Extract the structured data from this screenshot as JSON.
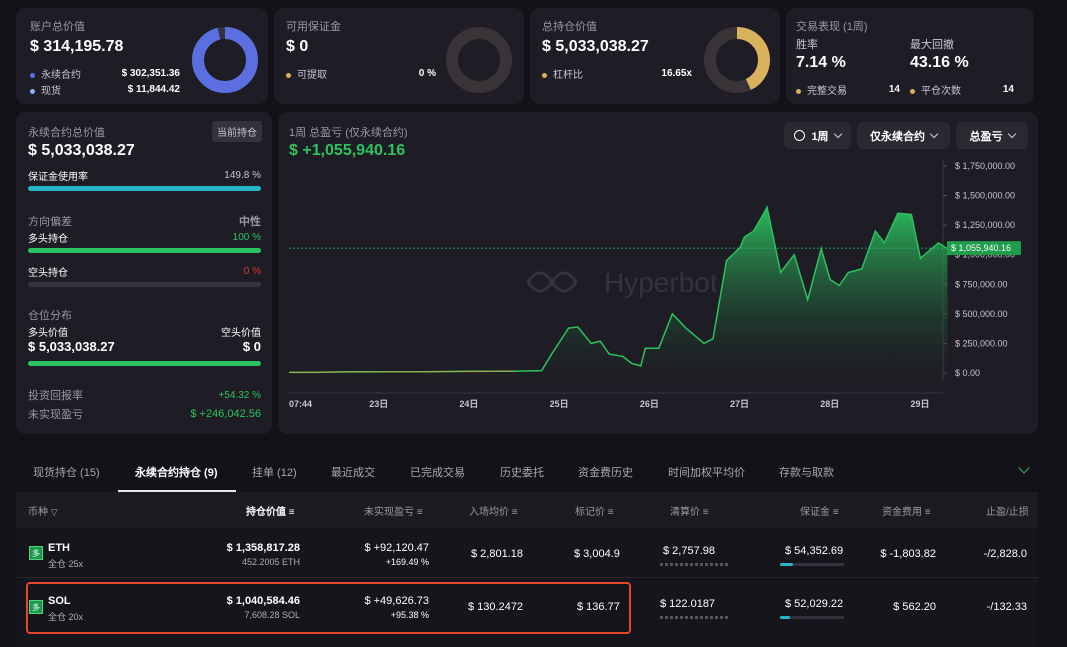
{
  "cards": {
    "account": {
      "label": "账户总价值",
      "value": "$ 314,195.78",
      "perp_label": "永续合约",
      "perp_value": "$ 302,351.36",
      "spot_label": "现货",
      "spot_value": "$ 11,844.42",
      "perp_fraction": 0.962
    },
    "margin": {
      "label": "可用保证金",
      "value": "$ 0",
      "withdraw_label": "可提取",
      "withdraw_value": "0 %",
      "fraction": 0
    },
    "position": {
      "label": "总持仓价值",
      "value": "$ 5,033,038.27",
      "leverage_label": "杠杆比",
      "leverage_value": "16.65x",
      "fraction": 0.43
    },
    "trading": {
      "label": "交易表现 (1周)",
      "winrate_label": "胜率",
      "winrate_value": "7.14 %",
      "drawdown_label": "最大回撤",
      "drawdown_value": "43.16 %",
      "completed_label": "完整交易",
      "completed_value": "14",
      "closes_label": "平仓次数",
      "closes_value": "14"
    }
  },
  "perp_panel": {
    "title": "永续合约总价值",
    "badge": "当前持仓",
    "value": "$ 5,033,038.27",
    "margin_usage_label": "保证金使用率",
    "margin_usage_value": "149.8 %",
    "bias_label": "方向偏差",
    "bias_value": "中性",
    "long_label": "多头持仓",
    "long_value": "100 %",
    "short_label": "空头持仓",
    "short_value": "0 %",
    "dist_label": "仓位分布",
    "long_val_label": "多头价值",
    "short_val_label": "空头价值",
    "long_val": "$ 5,033,038.27",
    "short_val": "$ 0",
    "roi_label": "投资回报率",
    "roi_value": "+54.32 %",
    "upnl_label": "未实现盈亏",
    "upnl_value": "$ +246,042.56"
  },
  "chart_header": {
    "title": "1周 总盈亏 (仅永续合约)",
    "value": "$ +1,055,940.16",
    "range_label": "1周",
    "filter_label": "仅永续合约",
    "metric_label": "总盈亏",
    "watermark": "Hyperbot"
  },
  "chart_data": {
    "type": "area",
    "x_labels": [
      "07:44",
      "23日",
      "24日",
      "25日",
      "26日",
      "27日",
      "28日",
      "29日"
    ],
    "y_ticks": [
      "$ 1,750,000.00",
      "$ 1,500,000.00",
      "$ 1,250,000.00",
      "$ 1,000,000.00",
      "$ 750,000.00",
      "$ 500,000.00",
      "$ 250,000.00",
      "$ 0.00"
    ],
    "ylim": [
      0,
      1750000
    ],
    "x_range": [
      0,
      7.25
    ],
    "current_label": "$ 1,055,940.16",
    "current_value": 1055940,
    "series": [
      {
        "x": [
          0,
          0.3,
          0.6,
          1,
          1.5,
          2,
          2.5,
          2.8,
          2.92,
          3.1,
          3.2,
          3.35,
          3.45,
          3.55,
          3.7,
          3.8,
          3.9,
          3.95,
          4.1,
          4.25,
          4.4,
          4.6,
          4.7,
          4.85,
          5,
          5.05,
          5.15,
          5.3,
          5.45,
          5.6,
          5.75,
          5.9,
          6,
          6.1,
          6.2,
          6.35,
          6.5,
          6.6,
          6.75,
          6.9,
          7,
          7.2,
          7.3
        ],
        "y": [
          5000,
          5000,
          10000,
          10000,
          10000,
          15000,
          15000,
          20000,
          170000,
          380000,
          390000,
          250000,
          270000,
          160000,
          140000,
          80000,
          60000,
          210000,
          210000,
          500000,
          380000,
          250000,
          290000,
          950000,
          1060000,
          1150000,
          1200000,
          1400000,
          850000,
          1000000,
          620000,
          1050000,
          790000,
          740000,
          850000,
          880000,
          1200000,
          1100000,
          1350000,
          1340000,
          970000,
          1100000,
          1050000
        ]
      }
    ]
  },
  "tabs": [
    "现货持仓 (15)",
    "永续合约持仓 (9)",
    "挂单 (12)",
    "最近成交",
    "已完成交易",
    "历史委托",
    "资金费历史",
    "时间加权平均价",
    "存款与取款"
  ],
  "table": {
    "headers": [
      "币种",
      "持仓价值",
      "未实现盈亏",
      "入场均价",
      "标记价",
      "清算价",
      "保证金",
      "资金费用",
      "止盈/止损"
    ],
    "rows": [
      {
        "badge": "多",
        "coin": "ETH",
        "mode": "全仓 25x",
        "value": "$ 1,358,817.28",
        "size": "452.2005 ETH",
        "pnl": "$ +92,120.47",
        "pnl_pct": "+169.49 %",
        "entry": "$ 2,801.18",
        "mark": "$ 3,004.9",
        "liq": "$ 2,757.98",
        "margin": "$ 54,352.69",
        "funding": "$ -1,803.82",
        "tpsl": "-/2,828.0"
      },
      {
        "badge": "多",
        "coin": "SOL",
        "mode": "全仓 20x",
        "value": "$ 1,040,584.46",
        "size": "7,608.28 SOL",
        "pnl": "$ +49,626.73",
        "pnl_pct": "+95.38 %",
        "entry": "$ 130.2472",
        "mark": "$ 136.77",
        "liq": "$ 122.0187",
        "margin": "$ 52,029.22",
        "funding": "$ 562.20",
        "tpsl": "-/132.33"
      }
    ]
  },
  "colors": {
    "accent_blue": "#5b6fe0",
    "gold": "#d9b25c",
    "green": "#2bc35f",
    "red": "#e03636",
    "highlight": "#e6452e"
  }
}
